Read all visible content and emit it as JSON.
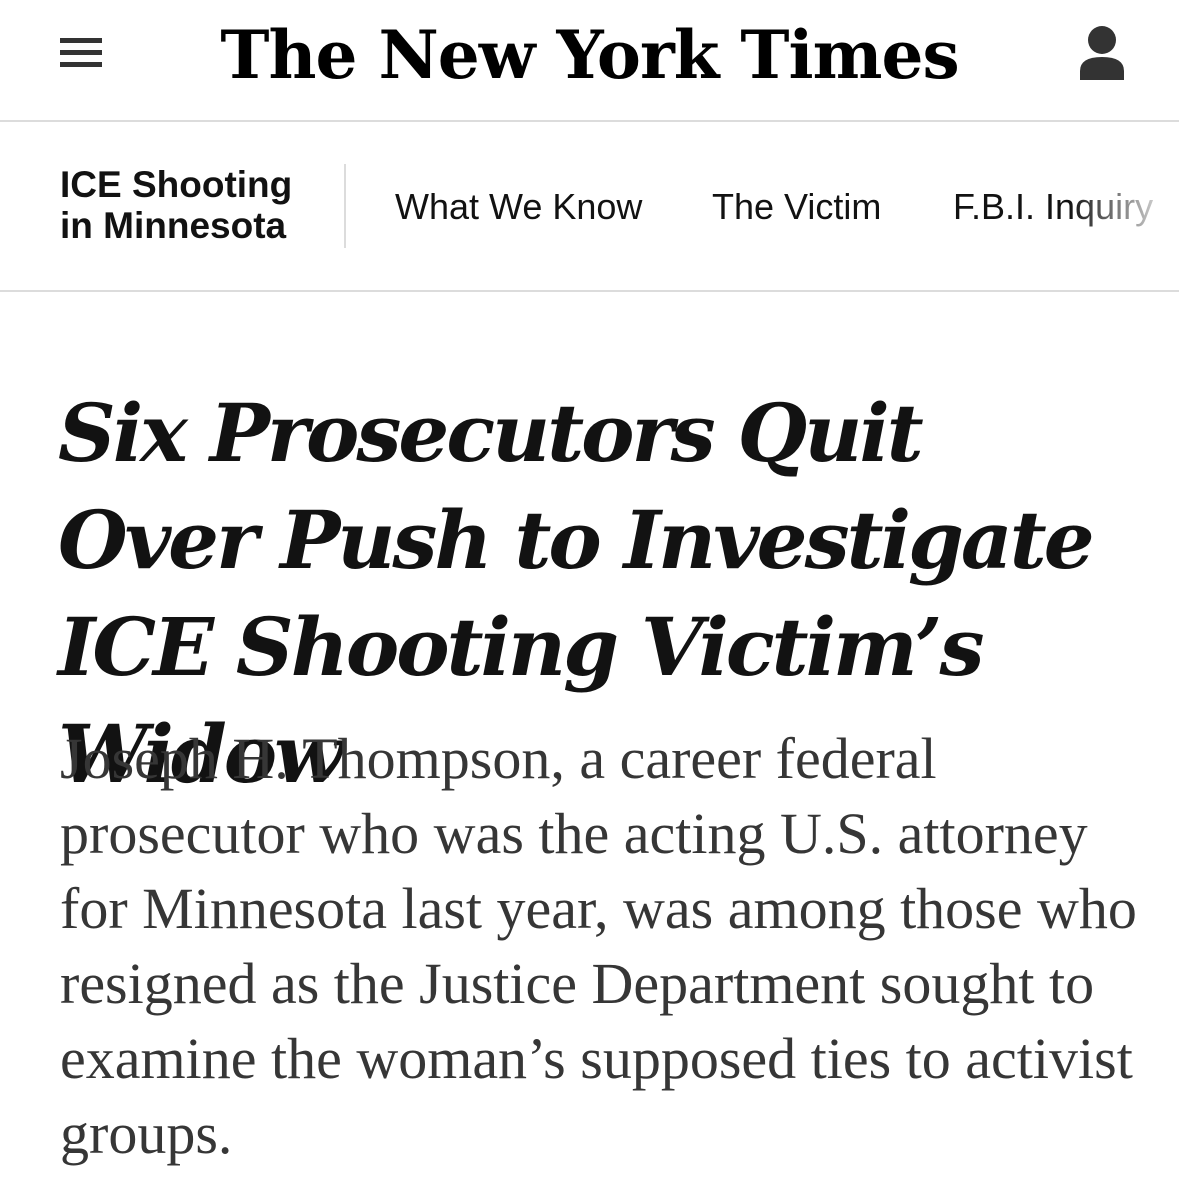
{
  "masthead": {
    "logo_text": "The New York Times",
    "menu_icon": "hamburger-menu-icon",
    "account_icon": "user-account-icon"
  },
  "section_nav": {
    "label": "ICE Shooting in Minnesota",
    "items": [
      {
        "label": "What We Know"
      },
      {
        "label": "The Victim"
      },
      {
        "label": "F.B.I. Inquiry"
      }
    ]
  },
  "article": {
    "headline": "Six Prosecutors Quit Over Push to Investigate ICE Shooting Victim’s Widow",
    "summary": "Joseph H. Thompson, a career federal prosecutor who was the acting U.S. attorney for Minnesota last year, was among those who resigned as the Justice Department sought to examine the woman’s supposed ties to activist groups."
  },
  "colors": {
    "text_primary": "#121212",
    "text_summary": "#363636",
    "divider": "#dcdcdc",
    "icon": "#333333"
  }
}
